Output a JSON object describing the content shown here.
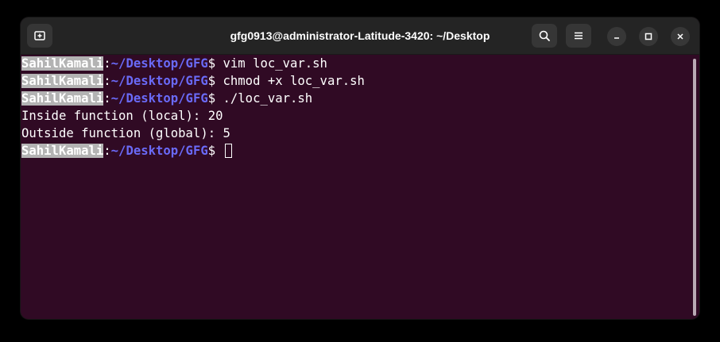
{
  "window": {
    "title": "gfg0913@administrator-Latitude-3420: ~/Desktop"
  },
  "titlebar": {
    "new_tab_icon": "new-tab-icon",
    "search_icon": "search-icon",
    "menu_icon": "hamburger-menu-icon",
    "minimize_icon": "minimize-icon",
    "maximize_icon": "maximize-icon",
    "close_icon": "close-icon"
  },
  "terminal": {
    "user": "SahilKamali",
    "colon": ":",
    "path": "~/Desktop/GFG",
    "prompt_symbol": "$",
    "lines": [
      {
        "type": "prompt",
        "command": " vim loc_var.sh"
      },
      {
        "type": "prompt",
        "command": " chmod +x loc_var.sh"
      },
      {
        "type": "prompt",
        "command": " ./loc_var.sh"
      },
      {
        "type": "output",
        "text": "Inside function (local): 20"
      },
      {
        "type": "output",
        "text": "Outside function (global): 5"
      },
      {
        "type": "prompt",
        "command": " "
      }
    ]
  },
  "colors": {
    "terminal_background": "#300a24",
    "titlebar_background": "#242424",
    "path_color": "#6a6af7",
    "user_highlight": "#b3b3b3",
    "text_color": "#ffffff"
  }
}
